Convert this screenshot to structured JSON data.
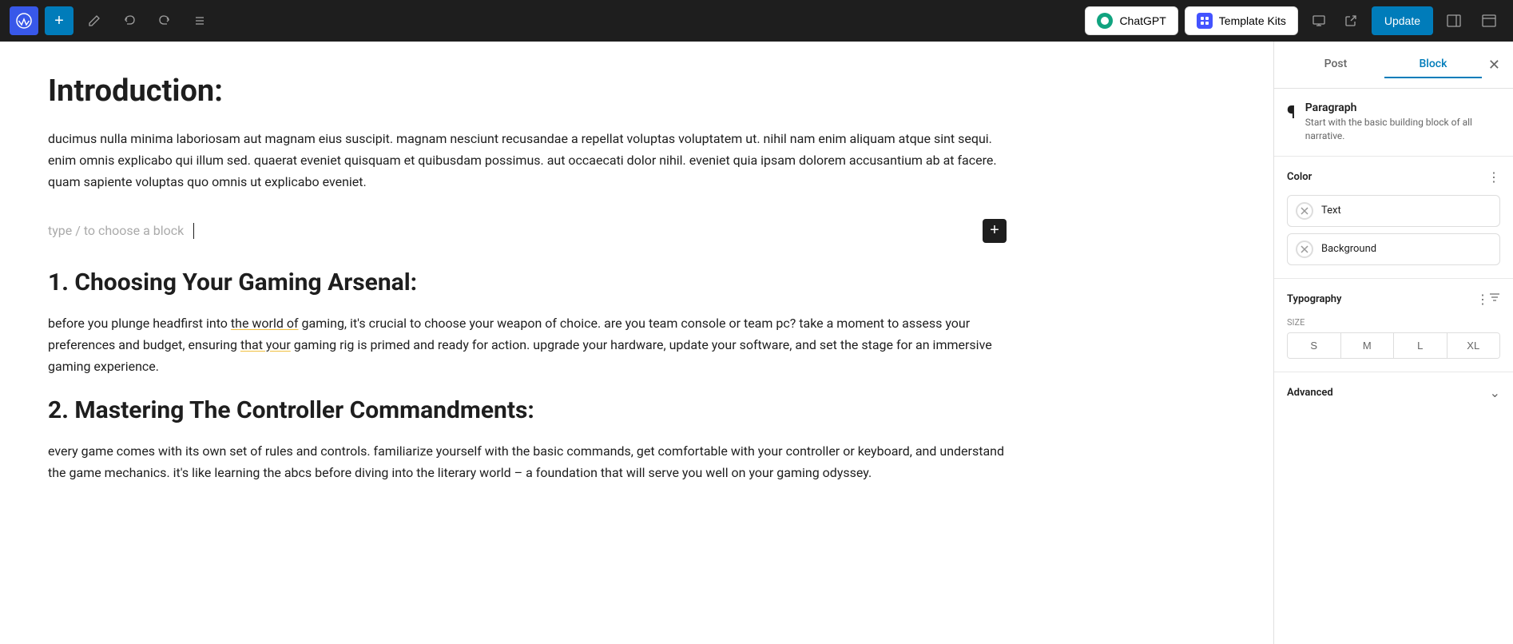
{
  "topbar": {
    "add_label": "+",
    "edit_label": "✎",
    "undo_label": "↩",
    "redo_label": "↪",
    "list_label": "≡",
    "chatgpt_label": "ChatGPT",
    "template_kits_label": "Template Kits",
    "update_label": "Update"
  },
  "editor": {
    "title": "Introduction:",
    "paragraph1": "ducimus nulla minima laboriosam aut magnam eius suscipit. magnam nesciunt recusandae a repellat voluptas voluptatem ut. nihil nam enim aliquam atque sint sequi. enim omnis explicabo qui illum sed. quaerat eveniet quisquam et quibusdam possimus. aut occaecati dolor nihil. eveniet quia ipsam dolorem accusantium ab at facere. quam sapiente voluptas quo omnis ut explicabo eveniet.",
    "block_placeholder": "type / to choose a block",
    "section1_heading": "1. Choosing Your Gaming Arsenal:",
    "paragraph2_before": "before you plunge headfirst into ",
    "paragraph2_highlight1": "the world of",
    "paragraph2_mid1": " gaming, it's crucial to choose your weapon of choice. are you team console or team pc? take a moment to assess your preferences and budget, ensuring ",
    "paragraph2_highlight2": "that your",
    "paragraph2_mid2": " gaming rig is primed and ready for action. upgrade your hardware, update your software, and set the stage for an immersive gaming experience.",
    "section2_heading": "2. Mastering The Controller Commandments:",
    "paragraph3": "every game comes with its own set of rules and controls. familiarize yourself with the basic commands, get comfortable with your controller or keyboard, and understand the game mechanics. it's like learning the abcs before diving into the literary world – a foundation that will serve you well on your gaming odyssey."
  },
  "panel": {
    "post_tab": "Post",
    "block_tab": "Block",
    "block_name": "Paragraph",
    "block_description": "Start with the basic building block of all narrative.",
    "color_section_title": "Color",
    "text_label": "Text",
    "background_label": "Background",
    "typography_section_title": "Typography",
    "size_label": "SIZE",
    "size_s": "S",
    "size_m": "M",
    "size_l": "L",
    "size_xl": "XL",
    "advanced_label": "Advanced"
  }
}
